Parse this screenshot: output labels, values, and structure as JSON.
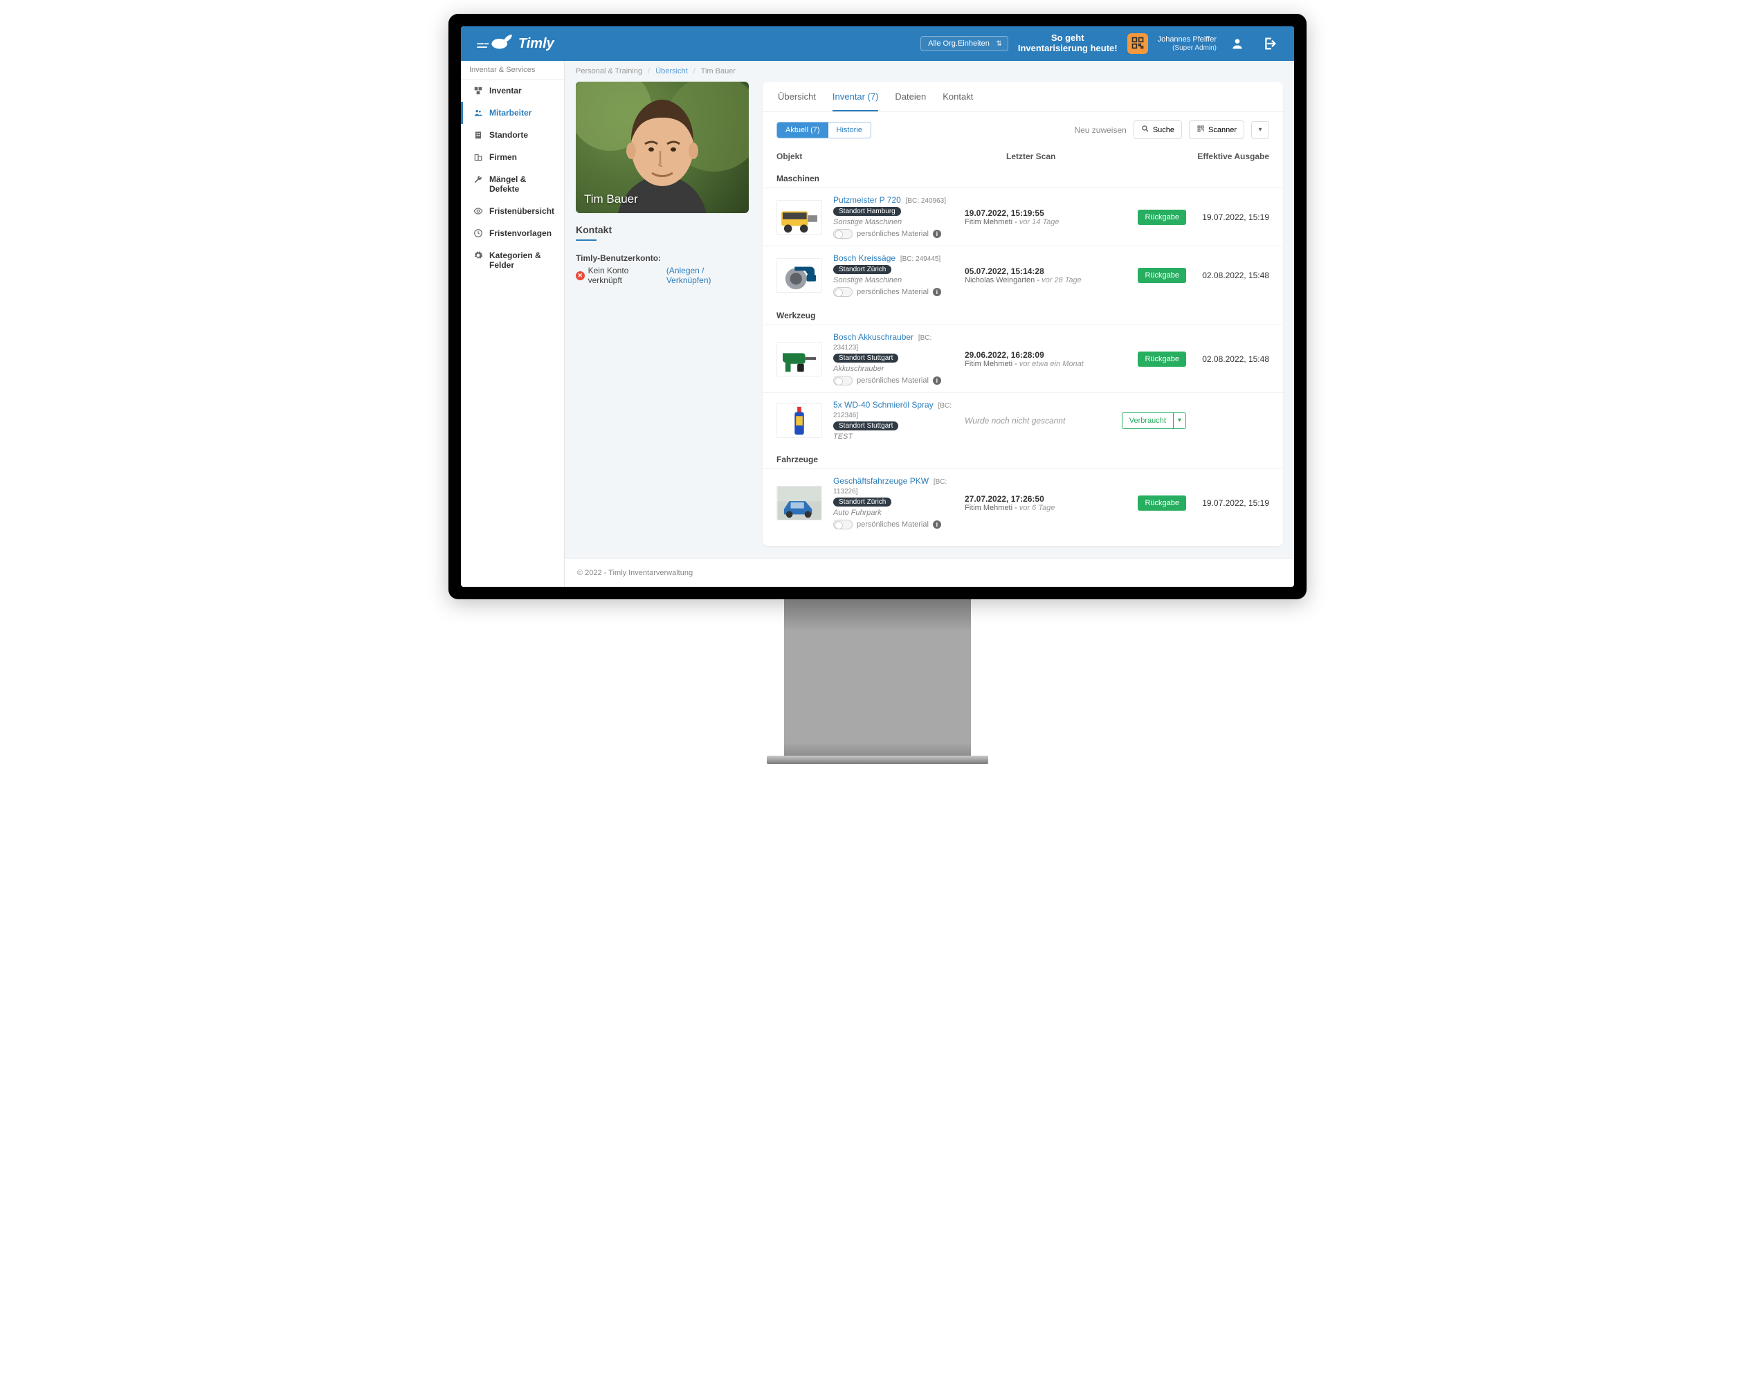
{
  "header": {
    "brand": "Timly",
    "org_select": "Alle Org.Einheiten",
    "tagline_line1": "So geht",
    "tagline_line2": "Inventarisierung heute!",
    "user_name": "Johannes Pfeiffer",
    "user_role": "(Super Admin)"
  },
  "sidebar": {
    "category": "Inventar & Services",
    "items": [
      {
        "label": "Inventar"
      },
      {
        "label": "Mitarbeiter"
      },
      {
        "label": "Standorte"
      },
      {
        "label": "Firmen"
      },
      {
        "label": "Mängel & Defekte"
      },
      {
        "label": "Fristenübersicht"
      },
      {
        "label": "Fristenvorlagen"
      },
      {
        "label": "Kategorien & Felder"
      }
    ]
  },
  "breadcrumb": {
    "root": "Personal & Training",
    "mid": "Übersicht",
    "leaf": "Tim Bauer"
  },
  "profile": {
    "name": "Tim Bauer",
    "contact_heading": "Kontakt",
    "account_label": "Timly-Benutzerkonto:",
    "no_account": "Kein Konto verknüpft",
    "link_text": "(Anlegen / Verknüpfen)"
  },
  "tabs": {
    "overview": "Übersicht",
    "inventory": "Inventar (7)",
    "files": "Dateien",
    "contact": "Kontakt"
  },
  "toolbar": {
    "current": "Aktuell (7)",
    "history": "Historie",
    "reassign": "Neu zuweisen",
    "search": "Suche",
    "scanner": "Scanner"
  },
  "grid": {
    "col_object": "Objekt",
    "col_scan": "Letzter Scan",
    "col_eff": "Effektive Ausgabe"
  },
  "common": {
    "rueckgabe": "Rückgabe",
    "verbraucht": "Verbraucht",
    "persmat": "persönliches Material",
    "not_scanned": "Wurde noch nicht gescannt"
  },
  "groups": [
    {
      "title": "Maschinen",
      "rows": [
        {
          "name": "Putzmeister P 720",
          "bc": "[BC: 240963]",
          "location": "Standort Hamburg",
          "subcat": "Sonstige Maschinen",
          "scan_time": "19.07.2022, 15:19:55",
          "scan_by": "Fitim Mehmeti",
          "scan_ago": "vor 14 Tage",
          "action": "rueckgabe",
          "effective": "19.07.2022, 15:19",
          "thumb": "compressor"
        },
        {
          "name": "Bosch Kreissäge",
          "bc": "[BC: 249445]",
          "location": "Standort Zürich",
          "subcat": "Sonstige Maschinen",
          "scan_time": "05.07.2022, 15:14:28",
          "scan_by": "Nicholas Weingarten",
          "scan_ago": "vor 28 Tage",
          "action": "rueckgabe",
          "effective": "02.08.2022, 15:48",
          "thumb": "saw"
        }
      ]
    },
    {
      "title": "Werkzeug",
      "rows": [
        {
          "name": "Bosch Akkuschrauber",
          "bc": "[BC: 234123]",
          "location": "Standort Stuttgart",
          "subcat": "Akkuschrauber",
          "scan_time": "29.06.2022, 16:28:09",
          "scan_by": "Fitim Mehmeti",
          "scan_ago": "vor etwa ein Monat",
          "action": "rueckgabe",
          "effective": "02.08.2022, 15:48",
          "thumb": "drill"
        },
        {
          "name": "5x WD-40 Schmieröl Spray",
          "bc": "[BC: 212346]",
          "location": "Standort Stuttgart",
          "subcat": "TEST",
          "scan_time": "",
          "scan_by": "",
          "scan_ago": "",
          "action": "verbraucht",
          "effective": "",
          "thumb": "spray"
        }
      ]
    },
    {
      "title": "Fahrzeuge",
      "rows": [
        {
          "name": "Geschäftsfahrzeuge PKW",
          "bc": "[BC: 113226]",
          "location": "Standort Zürich",
          "subcat": "Auto Fuhrpark",
          "scan_time": "27.07.2022, 17:26:50",
          "scan_by": "Fitim Mehmeti",
          "scan_ago": "vor 6 Tage",
          "action": "rueckgabe",
          "effective": "19.07.2022, 15:19",
          "thumb": "car"
        }
      ]
    }
  ],
  "footer": "© 2022 - Timly Inventarverwaltung"
}
